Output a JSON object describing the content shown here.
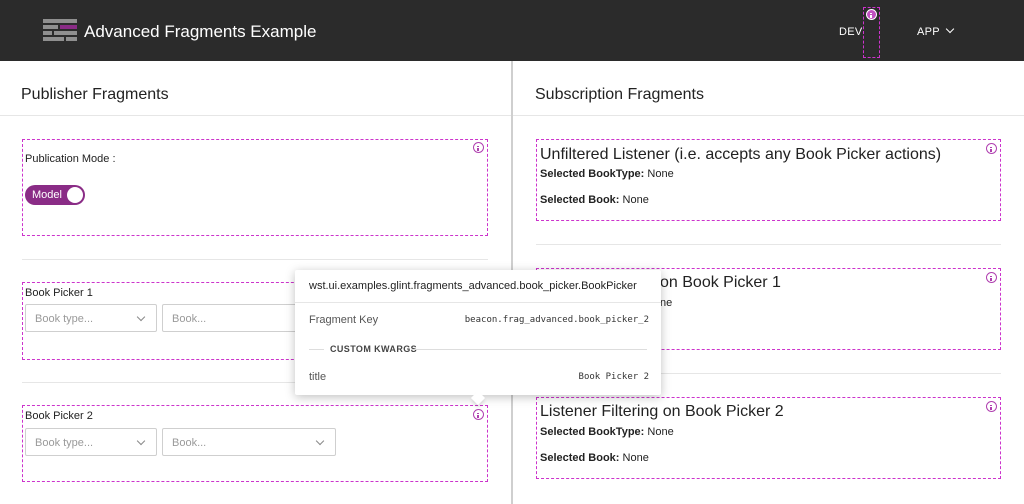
{
  "header": {
    "title": "Advanced Fragments Example",
    "nav": [
      {
        "label": "DEV"
      },
      {
        "label": "APP"
      }
    ]
  },
  "publisher": {
    "title": "Publisher Fragments",
    "publication_mode_label": "Publication Mode :",
    "toggle_label": "Model",
    "book_picker_1": {
      "title": "Book Picker 1",
      "type_placeholder": "Book type...",
      "book_placeholder": "Book..."
    },
    "book_picker_2": {
      "title": "Book Picker 2",
      "type_placeholder": "Book type...",
      "book_placeholder": "Book..."
    }
  },
  "subscription": {
    "title": "Subscription Fragments",
    "listeners": [
      {
        "title": "Unfiltered Listener (i.e. accepts any Book Picker actions)",
        "book_type_label": "Selected BookType:",
        "book_type_value": "None",
        "book_label": "Selected Book:",
        "book_value": "None"
      },
      {
        "title_partial": "on Book Picker 1",
        "book_type_value_partial": "ne"
      },
      {
        "title": "Listener Filtering on Book Picker 2",
        "book_type_label": "Selected BookType:",
        "book_type_value": "None",
        "book_label": "Selected Book:",
        "book_value": "None"
      }
    ]
  },
  "tooltip": {
    "class_path": "wst.ui.examples.glint.fragments_advanced.book_picker.BookPicker",
    "fragment_key_label": "Fragment Key",
    "fragment_key_value": "beacon.frag_advanced.book_picker_2",
    "custom_kwargs_label": "CUSTOM KWARGS",
    "kwargs": [
      {
        "key": "title",
        "value": "Book Picker 2"
      }
    ]
  },
  "colors": {
    "header_bg": "#2b2b2b",
    "accent": "#8a2c86",
    "fragment_outline": "#cc33cc"
  },
  "icons": [
    "app-logo-icon",
    "info-icon",
    "chevron-down-icon"
  ]
}
